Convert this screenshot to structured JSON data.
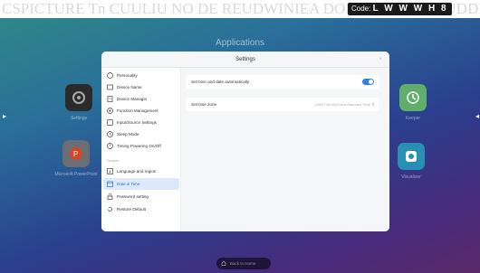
{
  "background_text": "CSPICTURE Tn CUULIU NO DE REUDWINIEA DOPU UNIULIC TUDDIIDINUD UT WATNIIU JUUT",
  "code_badge": {
    "prefix": "Code:",
    "code": "L W W W H 8"
  },
  "apps_title": "Applications",
  "apps": [
    {
      "label": "Settings",
      "icon": "settings-gear-icon"
    },
    {
      "label": "Microsoft PowerPoint",
      "icon": "powerpoint-icon"
    },
    {
      "label": "Keeper",
      "icon": "keeper-icon"
    },
    {
      "label": "Visualizer",
      "icon": "visualizer-icon"
    }
  ],
  "dialog": {
    "title": "Settings",
    "close": "×",
    "sidebar_items": [
      {
        "label": "Personality",
        "icon": "palette-icon"
      },
      {
        "label": "Device Name",
        "icon": "device-name-icon"
      },
      {
        "label": "Device Manager",
        "icon": "device-manager-icon"
      },
      {
        "label": "Function Management",
        "icon": "function-icon"
      },
      {
        "label": "Input/Source Settings",
        "icon": "input-source-icon"
      },
      {
        "label": "Sleep Mode",
        "icon": "sleep-icon"
      },
      {
        "label": "Timing Powering On/Off",
        "icon": "timer-icon"
      }
    ],
    "section_label": "System",
    "system_items": [
      {
        "label": "Language and region",
        "icon": "language-icon"
      },
      {
        "label": "Date & Time",
        "icon": "calendar-icon",
        "active": true
      },
      {
        "label": "Password setting",
        "icon": "lock-icon"
      },
      {
        "label": "Restore Default",
        "icon": "restore-icon"
      }
    ],
    "rows": {
      "auto_time": {
        "label": "Set time and date automatically",
        "enabled": true
      },
      "time_zone": {
        "label": "Set time zone",
        "value": "(GMT+08:00)China Standard Time"
      }
    }
  },
  "home_button": {
    "label": "Back to Home",
    "icon": "home-icon"
  },
  "colors": {
    "accent": "#2f80ed",
    "active_bg": "#dbe9fb"
  }
}
